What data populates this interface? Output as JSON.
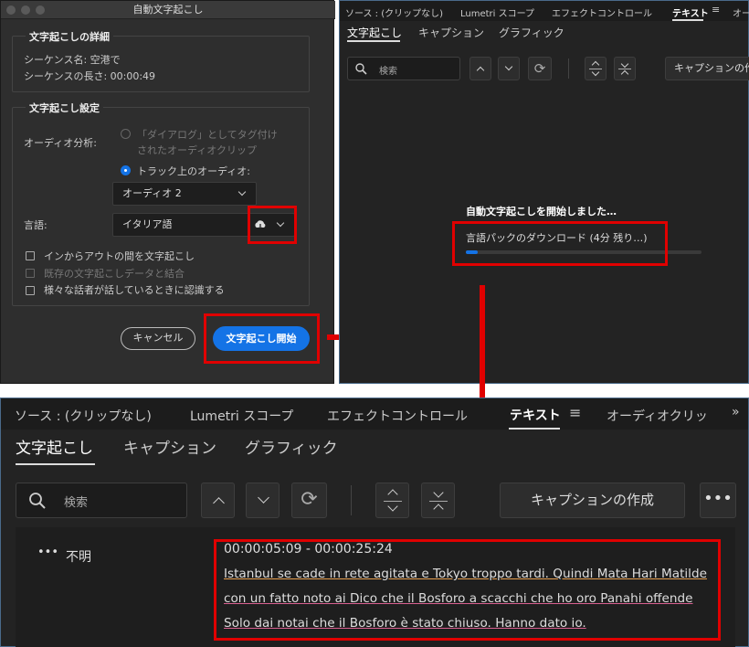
{
  "dialog": {
    "title": "自動文字起こし",
    "details": {
      "heading": "文字起こしの詳細",
      "sequence_name": "シーケンス名: 空港で",
      "sequence_length": "シーケンスの長さ: 00:00:49"
    },
    "settings": {
      "heading": "文字起こし設定",
      "audio_analysis_label": "オーディオ分析:",
      "radio_dialogue_line1": "「ダイアログ」としてタグ付け",
      "radio_dialogue_line2": "されたオーディオクリップ",
      "radio_track": "トラック上のオーディオ:",
      "track_select": "オーディオ 2",
      "language_label": "言語:",
      "language_select": "イタリア語",
      "checkbox_inout": "インからアウトの間を文字起こし",
      "checkbox_merge": "既存の文字起こしデータと結合",
      "checkbox_speakers": "様々な話者が話しているときに認識する"
    },
    "cancel": "キャンセル",
    "start": "文字起こし開始"
  },
  "top_panel": {
    "tabs": [
      "ソース : (クリップなし)",
      "Lumetri スコープ",
      "エフェクトコントロール",
      "テキスト",
      "オー"
    ],
    "subtabs": [
      "文字起こし",
      "キャプション",
      "グラフィック"
    ],
    "search_placeholder": "検索",
    "create_caption": "キャプションの作",
    "status": "自動文字起こしを開始しました…",
    "download": "言語パックのダウンロード (4分 残り…)",
    "progress": 0.05
  },
  "bottom_panel": {
    "tabs": [
      "ソース : (クリップなし)",
      "Lumetri スコープ",
      "エフェクトコントロール",
      "テキスト",
      "オーディオクリッ"
    ],
    "subtabs": [
      "文字起こし",
      "キャプション",
      "グラフィック"
    ],
    "search_placeholder": "検索",
    "create_caption": "キャプションの作成",
    "speaker": "不明",
    "timecode": "00:00:05:09 - 00:00:25:24",
    "line1": "Istanbul se cade in rete agitata e Tokyo troppo tardi. Quindi Mata Hari Matilde",
    "line2": "con un fatto noto ai Dico che il Bosforo a scacchi che ho oro Panahi offende",
    "line3": "Solo dai notai che il Bosforo è stato chiuso. Hanno dato io."
  },
  "colors": {
    "accent": "#1473e6",
    "annotation": "#e00000"
  }
}
